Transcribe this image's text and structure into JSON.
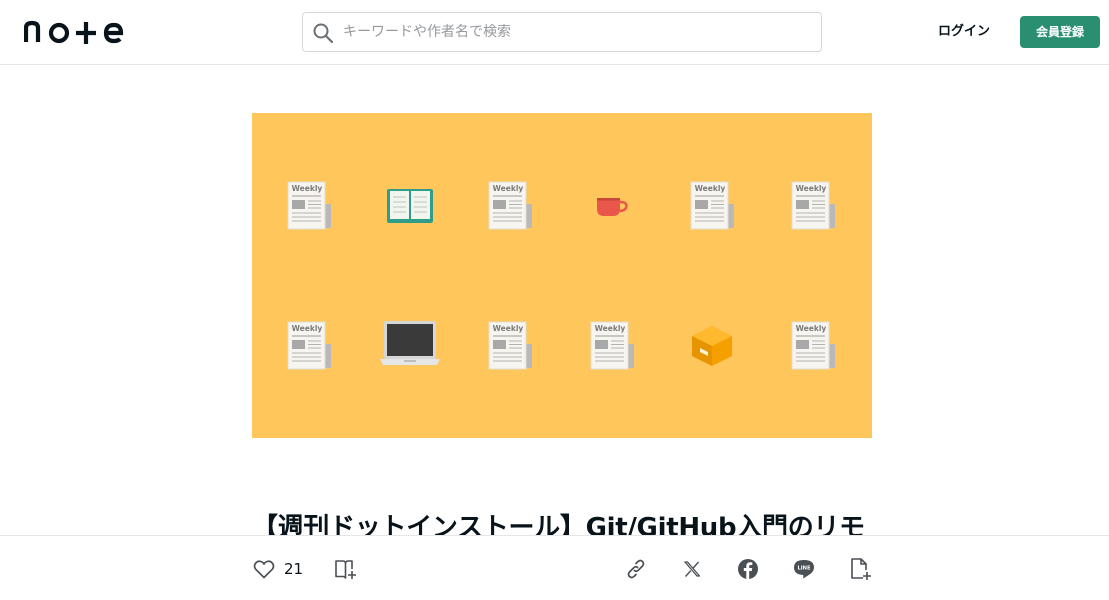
{
  "header": {
    "logo_text": "note",
    "search": {
      "placeholder": "キーワードや作者名で検索",
      "value": ""
    },
    "login_label": "ログイン",
    "signup_label": "会員登録"
  },
  "hero": {
    "background": "#ffc65c",
    "newspaper_caption": "Weekly",
    "items_row1": [
      "newspaper-icon",
      "book-icon",
      "newspaper-icon",
      "cup-icon",
      "newspaper-icon",
      "newspaper-icon"
    ],
    "items_row2": [
      "newspaper-icon",
      "laptop-icon",
      "newspaper-icon",
      "newspaper-icon",
      "box-icon",
      "newspaper-icon"
    ]
  },
  "article": {
    "title": "【週刊ドットインストール】Git/GitHub入門のリモ"
  },
  "actions": {
    "like_count": "21",
    "icons": [
      "heart-icon",
      "magazine-add-icon",
      "link-icon",
      "x-icon",
      "facebook-icon",
      "line-icon",
      "note-add-icon"
    ]
  },
  "colors": {
    "accent": "#2a8f70",
    "hero_bg": "#ffc65c",
    "text": "#08131a"
  }
}
